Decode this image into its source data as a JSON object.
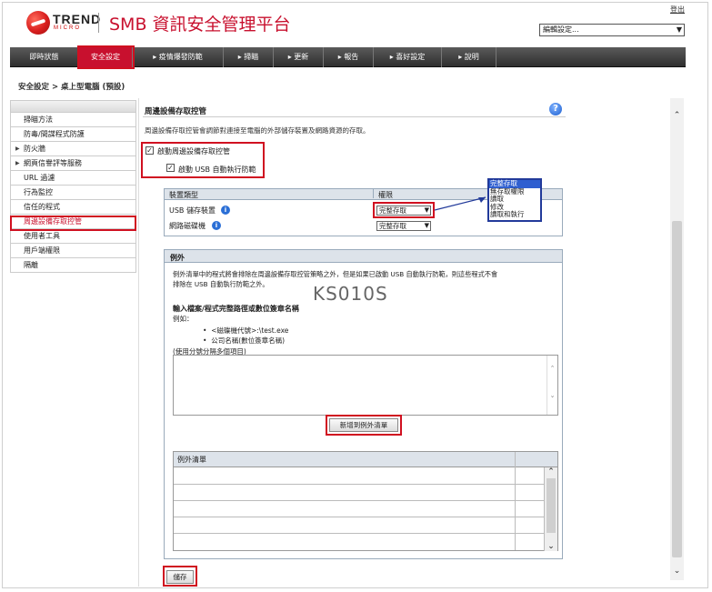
{
  "header": {
    "logo_text": "TREND",
    "logo_sub": "MICRO",
    "app_title": "SMB 資訊安全管理平台",
    "logout": "登出",
    "edit_select": "編輯設定..."
  },
  "nav": [
    {
      "label": "即時狀態"
    },
    {
      "label": "安全設定"
    },
    {
      "label": "▸ 疫情爆發防範"
    },
    {
      "label": "▸ 掃瞄"
    },
    {
      "label": "▸ 更新"
    },
    {
      "label": "▸ 報告"
    },
    {
      "label": "▸ 喜好設定"
    },
    {
      "label": "▸ 說明"
    }
  ],
  "breadcrumb": "安全設定 > 桌上型電腦 (預設)",
  "left_menu": [
    {
      "label": "掃瞄方法"
    },
    {
      "label": "防毒/間諜程式防護"
    },
    {
      "label": "防火牆"
    },
    {
      "label": "網頁信譽評等服務"
    },
    {
      "label": "URL 過濾"
    },
    {
      "label": "行為監控"
    },
    {
      "label": "信任的程式"
    },
    {
      "label": "周邊設備存取控管"
    },
    {
      "label": "使用者工具"
    },
    {
      "label": "用戶端權限"
    },
    {
      "label": "隔離"
    }
  ],
  "main": {
    "title": "周邊設備存取控管",
    "description": "周邊設備存取控管會調節對連接至電腦的外部儲存裝置及網路資源的存取。",
    "enable_label": "啟動周邊設備存取控管",
    "usb_autorun_label": "啟動 USB 自動執行防範",
    "device_table": {
      "col_type": "裝置類型",
      "col_perm": "權限",
      "rows": [
        {
          "type": "USB 儲存裝置",
          "perm": "完整存取"
        },
        {
          "type": "網路磁碟機",
          "perm": "完整存取"
        }
      ]
    },
    "perm_options": [
      "完整存取",
      "無存取權限",
      "讀取",
      "修改",
      "讀取和執行"
    ],
    "exceptions": {
      "title": "例外",
      "desc_line1": "例外清單中的程式將會排除在周邊設備存取控管策略之外，但是如果已啟動 USB 自動執行防範，則這些程式不會",
      "desc_line2": "排除在 USB 自動執行防範之外。",
      "input_title": "輸入檔案/程式完整路徑或數位簽章名稱",
      "example_label": "例如：",
      "example1": "<磁碟機代號>:\\test.exe",
      "example2": "公司名稱(數位簽章名稱)",
      "hint": "(使用分號分隔多個項目)",
      "add_button": "新增到例外清單",
      "list_header": "例外清單"
    },
    "save_button": "儲存"
  },
  "watermark": "KS010S"
}
